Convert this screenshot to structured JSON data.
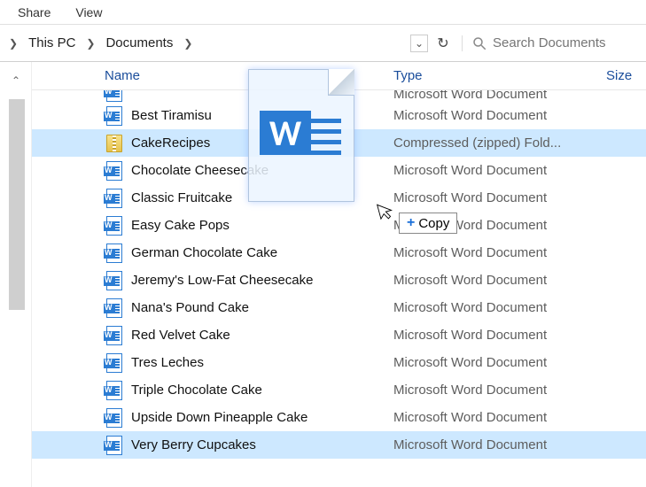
{
  "ribbon": {
    "share": "Share",
    "view": "View"
  },
  "breadcrumb": {
    "arrow": "❯",
    "seg1": "This PC",
    "seg2": "Documents"
  },
  "addr": {
    "dropdown": "⌄",
    "refresh": "↻"
  },
  "search": {
    "placeholder": "Search Documents"
  },
  "columns": {
    "name": "Name",
    "type": "Type",
    "size": "Size"
  },
  "drag": {
    "copy_label": "Copy",
    "plus": "+"
  },
  "type_word": "Microsoft Word Document",
  "type_zip": "Compressed (zipped) Fold...",
  "files": [
    {
      "name": "Best Tiramisu",
      "type_key": "word"
    },
    {
      "name": "CakeRecipes",
      "type_key": "zip",
      "selected": true
    },
    {
      "name": "Chocolate Cheesecake",
      "type_key": "word"
    },
    {
      "name": "Classic Fruitcake",
      "type_key": "word"
    },
    {
      "name": "Easy Cake Pops",
      "type_key": "word"
    },
    {
      "name": "German Chocolate Cake",
      "type_key": "word"
    },
    {
      "name": "Jeremy's Low-Fat Cheesecake",
      "type_key": "word"
    },
    {
      "name": "Nana's Pound Cake",
      "type_key": "word"
    },
    {
      "name": "Red Velvet Cake",
      "type_key": "word"
    },
    {
      "name": "Tres Leches",
      "type_key": "word"
    },
    {
      "name": "Triple Chocolate Cake",
      "type_key": "word"
    },
    {
      "name": "Upside Down Pineapple Cake",
      "type_key": "word"
    },
    {
      "name": "Very Berry Cupcakes",
      "type_key": "word",
      "selected": true
    }
  ],
  "partial_top_type": "Microsoft Word Document"
}
